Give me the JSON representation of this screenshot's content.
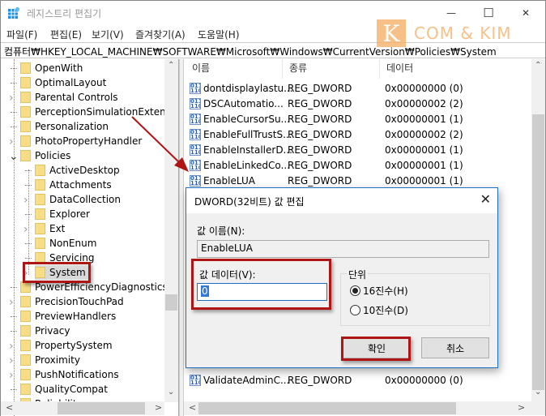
{
  "window": {
    "title": "레지스트리 편집기",
    "controls": {
      "minimize": "—",
      "maximize": "☐",
      "close": "✕"
    }
  },
  "watermark": {
    "letter": "K",
    "text": "COM & KIM",
    "color": "#f6b673"
  },
  "menu": [
    "파일(F)",
    "편집(E)",
    "보기(V)",
    "즐겨찾기(A)",
    "도움말(H)"
  ],
  "address": "컴퓨터₩HKEY_LOCAL_MACHINE₩SOFTWARE₩Microsoft₩Windows₩CurrentVersion₩Policies₩System",
  "tree": {
    "items": [
      {
        "label": "OpenWith",
        "level": 0,
        "expand": false
      },
      {
        "label": "OptimalLayout",
        "level": 0,
        "expand": false
      },
      {
        "label": "Parental Controls",
        "level": 0,
        "expand": true
      },
      {
        "label": "PerceptionSimulationExtensions",
        "level": 0,
        "expand": false
      },
      {
        "label": "Personalization",
        "level": 0,
        "expand": false
      },
      {
        "label": "PhotoPropertyHandler",
        "level": 0,
        "expand": true
      },
      {
        "label": "Policies",
        "level": 0,
        "expand": "open"
      },
      {
        "label": "ActiveDesktop",
        "level": 1,
        "expand": false
      },
      {
        "label": "Attachments",
        "level": 1,
        "expand": false
      },
      {
        "label": "DataCollection",
        "level": 1,
        "expand": true
      },
      {
        "label": "Explorer",
        "level": 1,
        "expand": false
      },
      {
        "label": "Ext",
        "level": 1,
        "expand": true
      },
      {
        "label": "NonEnum",
        "level": 1,
        "expand": false
      },
      {
        "label": "Servicing",
        "level": 1,
        "expand": false
      },
      {
        "label": "System",
        "level": 1,
        "expand": true,
        "selected": true
      },
      {
        "label": "PowerEfficiencyDiagnostics",
        "level": 0,
        "expand": false
      },
      {
        "label": "PrecisionTouchPad",
        "level": 0,
        "expand": true
      },
      {
        "label": "PreviewHandlers",
        "level": 0,
        "expand": false
      },
      {
        "label": "Privacy",
        "level": 0,
        "expand": false
      },
      {
        "label": "PropertySystem",
        "level": 0,
        "expand": true
      },
      {
        "label": "Proximity",
        "level": 0,
        "expand": true
      },
      {
        "label": "PushNotifications",
        "level": 0,
        "expand": true
      },
      {
        "label": "QualityCompat",
        "level": 0,
        "expand": false
      },
      {
        "label": "Reliability",
        "level": 0,
        "expand": false
      }
    ]
  },
  "list": {
    "headers": [
      "이름",
      "종류",
      "데이터"
    ],
    "rows": [
      {
        "name": "dontdisplaylastu...",
        "type": "REG_DWORD",
        "data": "0x00000000 (0)"
      },
      {
        "name": "DSCAutomatio...",
        "type": "REG_DWORD",
        "data": "0x00000002 (2)"
      },
      {
        "name": "EnableCursorSu...",
        "type": "REG_DWORD",
        "data": "0x00000001 (1)"
      },
      {
        "name": "EnableFullTrustS...",
        "type": "REG_DWORD",
        "data": "0x00000002 (2)"
      },
      {
        "name": "EnableInstallerD...",
        "type": "REG_DWORD",
        "data": "0x00000001 (1)"
      },
      {
        "name": "EnableLinkedCo...",
        "type": "REG_DWORD",
        "data": "0x00000001 (1)"
      },
      {
        "name": "EnableLUA",
        "type": "REG_DWORD",
        "data": "0x00000001 (1)"
      }
    ],
    "last_row": {
      "name": "ValidateAdminC...",
      "type": "REG_DWORD",
      "data": "0x00000000 (0)"
    },
    "icon_text": "011\n110"
  },
  "dialog": {
    "title": "DWORD(32비트) 값 편집",
    "name_label": "값 이름(N):",
    "name_value": "EnableLUA",
    "data_label": "값 데이터(V):",
    "data_value": "0",
    "base_label": "단위",
    "radio_hex": "16진수(H)",
    "radio_dec": "10진수(D)",
    "selected_base": "hex",
    "ok": "확인",
    "cancel": "취소"
  },
  "annotation_color": "#b01515"
}
